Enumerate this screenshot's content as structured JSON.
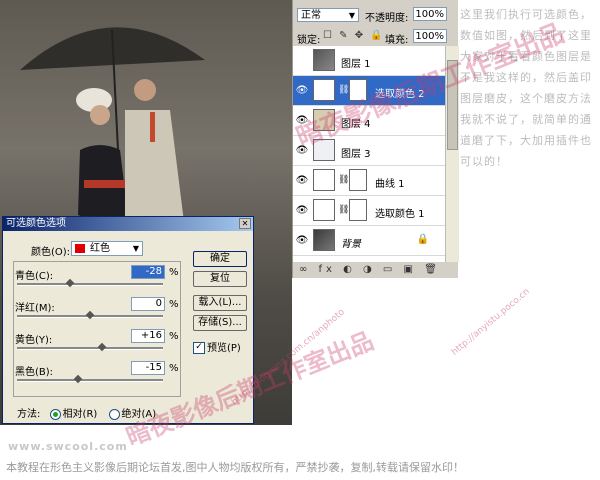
{
  "layers_panel": {
    "blend_mode": "正常",
    "opacity_label": "不透明度:",
    "opacity_value": "100%",
    "lock_label": "锁定:",
    "fill_label": "填充:",
    "fill_value": "100%",
    "layers": [
      {
        "name": "图层 1",
        "visible": false,
        "selected": false
      },
      {
        "name": "选取颜色 2",
        "visible": true,
        "selected": true
      },
      {
        "name": "图层 4",
        "visible": true,
        "selected": false
      },
      {
        "name": "图层 3",
        "visible": true,
        "selected": false
      },
      {
        "name": "曲线 1",
        "visible": true,
        "selected": false
      },
      {
        "name": "选取颜色 1",
        "visible": true,
        "selected": false
      },
      {
        "name": "背景",
        "visible": true,
        "selected": false
      }
    ]
  },
  "dialog": {
    "title": "可选颜色选项",
    "colors_label": "颜色(O):",
    "colors_value": "红色",
    "sliders": [
      {
        "label": "青色(C):",
        "value": "-28",
        "unit": "%",
        "fraction": 0.36
      },
      {
        "label": "洋红(M):",
        "value": "0",
        "unit": "%",
        "fraction": 0.5
      },
      {
        "label": "黄色(Y):",
        "value": "+16",
        "unit": "%",
        "fraction": 0.58
      },
      {
        "label": "黑色(B):",
        "value": "-15",
        "unit": "%",
        "fraction": 0.42
      }
    ],
    "ok_label": "确定",
    "reset_label": "复位",
    "load_label": "载入(L)...",
    "save_label": "存储(S)...",
    "preview_label": "预览(P)",
    "method_label": "方法:",
    "relative_label": "相对(R)",
    "absolute_label": "绝对(A)"
  },
  "side_text": "这里我们执行可选颜色，数值如图，然后到了这里大家对于看看颜色图层是不是我这样的，然后盖印图层磨皮，这个磨皮方法我就不说了，就简单的通道磨了下，大加用插件也可以的！",
  "footer": {
    "url": "www.swcool.com",
    "note": "本教程在形色主义影像后期论坛首发,图中人物均版权所有，严禁抄袭，复制,转载请保留水印！"
  },
  "watermarks": {
    "main": "暗夜影像后期工作室出品",
    "blog": "http://blog.sina.com.cn/anphoto",
    "tieba": "http://anyistu.poco.cn"
  },
  "colors": {
    "selection": "#3169c6",
    "dialog_bg": "#ece9d8",
    "watermark": "#c83c6e"
  }
}
